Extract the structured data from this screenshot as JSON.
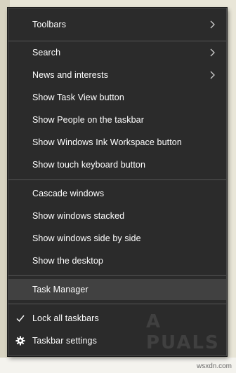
{
  "menu": {
    "items": [
      {
        "label": "Toolbars",
        "submenu": true
      },
      {
        "label": "Search",
        "submenu": true
      },
      {
        "label": "News and interests",
        "submenu": true
      },
      {
        "label": "Show Task View button"
      },
      {
        "label": "Show People on the taskbar"
      },
      {
        "label": "Show Windows Ink Workspace button"
      },
      {
        "label": "Show touch keyboard button"
      },
      {
        "label": "Cascade windows"
      },
      {
        "label": "Show windows stacked"
      },
      {
        "label": "Show windows side by side"
      },
      {
        "label": "Show the desktop"
      },
      {
        "label": "Task Manager",
        "highlighted": true
      },
      {
        "label": "Lock all taskbars",
        "checked": true,
        "icon": "checkmark-icon"
      },
      {
        "label": "Taskbar settings",
        "icon": "gear-icon"
      }
    ]
  },
  "watermark": {
    "logo_text": "A  PUALS",
    "site": "wsxdn.com"
  },
  "colors": {
    "menu_bg": "#2b2b2b",
    "hover_bg": "#414141",
    "separator": "#555555",
    "text": "#ffffff"
  }
}
